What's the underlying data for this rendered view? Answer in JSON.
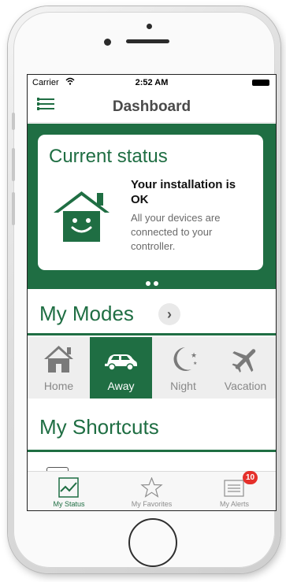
{
  "statusbar": {
    "carrier": "Carrier",
    "time": "2:52 AM"
  },
  "navbar": {
    "title": "Dashboard"
  },
  "status_card": {
    "title": "Current status",
    "headline": "Your installation is OK",
    "detail": "All your devices are connected to your controller.",
    "pager_pages": 2
  },
  "modes": {
    "title": "My Modes",
    "items": [
      {
        "label": "Home",
        "icon": "house-icon",
        "active": false
      },
      {
        "label": "Away",
        "icon": "car-icon",
        "active": true
      },
      {
        "label": "Night",
        "icon": "moon-icon",
        "active": false
      },
      {
        "label": "Vacation",
        "icon": "airplane-icon",
        "active": false
      }
    ]
  },
  "shortcuts": {
    "title": "My Shortcuts"
  },
  "tabbar": {
    "items": [
      {
        "label": "My Status",
        "icon": "pulse-chart-icon",
        "active": true
      },
      {
        "label": "My Favorites",
        "icon": "star-icon",
        "active": false
      },
      {
        "label": "My Alerts",
        "icon": "alerts-list-icon",
        "active": false,
        "badge": "10"
      }
    ]
  },
  "colors": {
    "brand_green": "#1f6e43",
    "badge_red": "#e5302b"
  }
}
